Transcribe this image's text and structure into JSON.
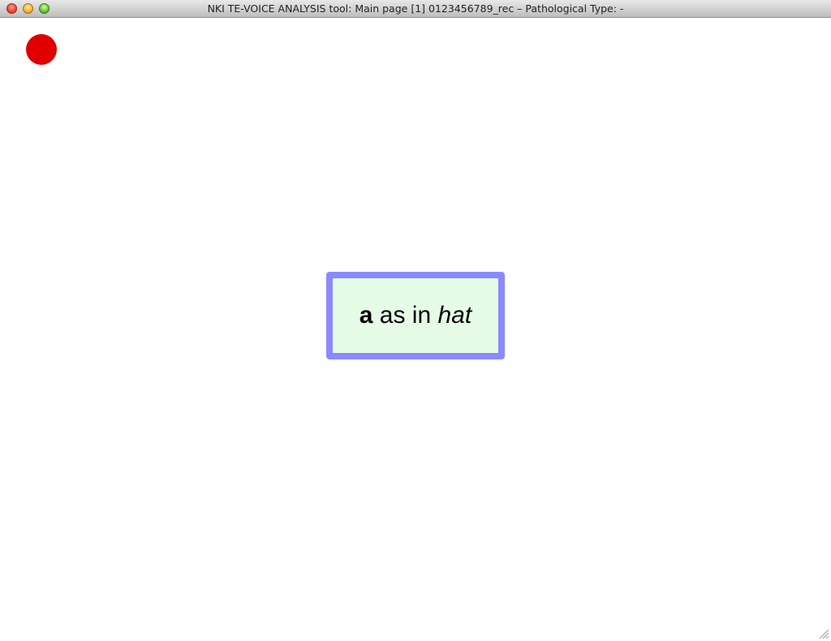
{
  "window": {
    "title": "NKI TE-VOICE ANALYSIS tool: Main page [1] 0123456789_rec – Pathological Type: -"
  },
  "traffic_lights": [
    {
      "name": "close",
      "color": "#f0483a"
    },
    {
      "name": "minimize",
      "color": "#f6b73a"
    },
    {
      "name": "zoom",
      "color": "#70c83c"
    }
  ],
  "record_indicator": {
    "color": "#e00000",
    "icon": "record-dot-icon"
  },
  "prompt": {
    "vowel": "a",
    "connector": " as in ",
    "example_word": "hat",
    "border_color": "#8a8aff",
    "background_color": "#e6fbe6"
  },
  "resize_grip": {
    "icon": "resize-grip-icon"
  }
}
